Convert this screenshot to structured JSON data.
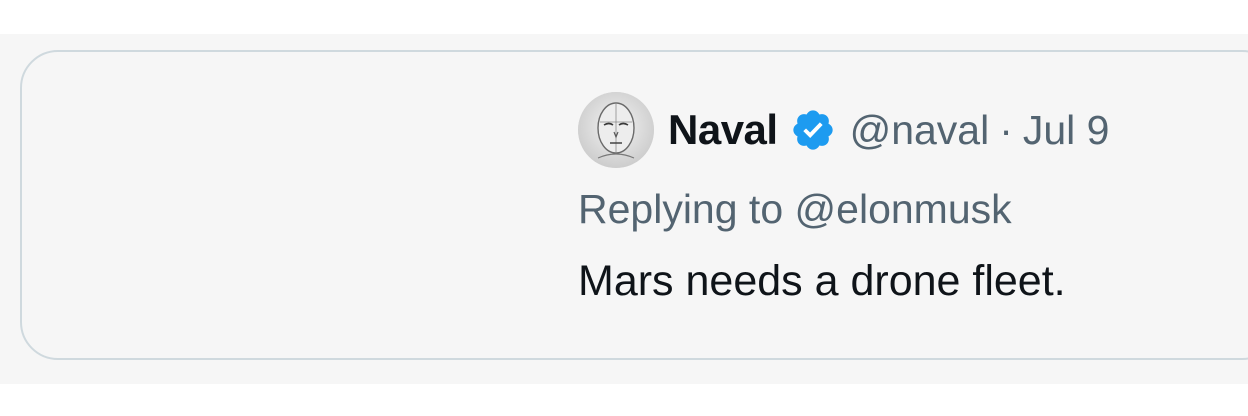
{
  "quoted_tweet": {
    "author": {
      "name": "Naval",
      "handle": "@naval",
      "verified": true,
      "avatar_icon": "sketched-face-avatar"
    },
    "separator": "·",
    "date": "Jul 9",
    "reply_prefix": "Replying to",
    "reply_to": "@elonmusk",
    "text": "Mars needs a drone fleet."
  },
  "colors": {
    "card_background": "#f6f6f6",
    "card_border": "#cfd9de",
    "primary_text": "#0f1419",
    "secondary_text": "#536471",
    "verified_badge": "#1d9bf0"
  }
}
